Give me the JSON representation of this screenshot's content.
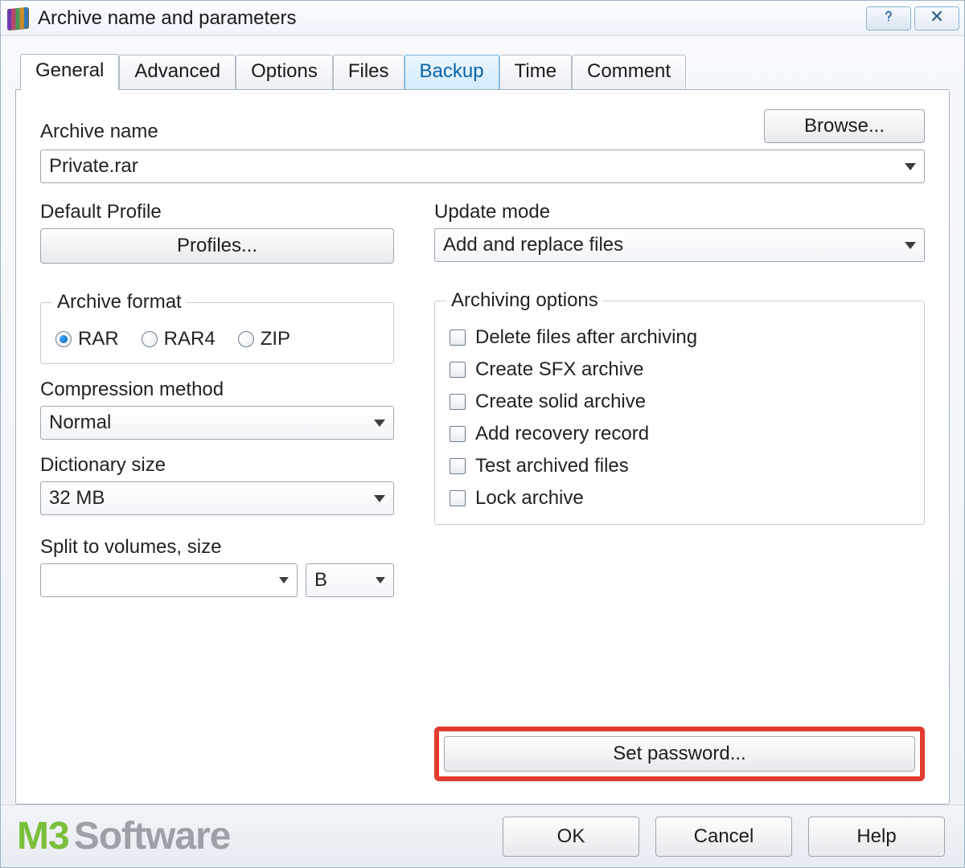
{
  "window": {
    "title": "Archive name and parameters"
  },
  "titlebar_buttons": {
    "help_name": "help-icon",
    "close_name": "close-icon"
  },
  "tabs": [
    {
      "label": "General",
      "active": true
    },
    {
      "label": "Advanced",
      "active": false
    },
    {
      "label": "Options",
      "active": false
    },
    {
      "label": "Files",
      "active": false
    },
    {
      "label": "Backup",
      "active": false,
      "highlight": true
    },
    {
      "label": "Time",
      "active": false
    },
    {
      "label": "Comment",
      "active": false
    }
  ],
  "archive_name": {
    "label": "Archive name",
    "value": "Private.rar",
    "browse_label": "Browse..."
  },
  "default_profile": {
    "label": "Default Profile",
    "button_label": "Profiles..."
  },
  "update_mode": {
    "label": "Update mode",
    "value": "Add and replace files"
  },
  "archive_format": {
    "legend": "Archive format",
    "options": [
      {
        "label": "RAR",
        "checked": true
      },
      {
        "label": "RAR4",
        "checked": false
      },
      {
        "label": "ZIP",
        "checked": false
      }
    ]
  },
  "compression_method": {
    "label": "Compression method",
    "value": "Normal"
  },
  "dictionary_size": {
    "label": "Dictionary size",
    "value": "32 MB"
  },
  "split_volumes": {
    "label": "Split to volumes, size",
    "value": "",
    "unit": "B"
  },
  "archiving_options": {
    "legend": "Archiving options",
    "items": [
      {
        "label": "Delete files after archiving",
        "checked": false
      },
      {
        "label": "Create SFX archive",
        "checked": false
      },
      {
        "label": "Create solid archive",
        "checked": false
      },
      {
        "label": "Add recovery record",
        "checked": false
      },
      {
        "label": "Test archived files",
        "checked": false
      },
      {
        "label": "Lock archive",
        "checked": false
      }
    ]
  },
  "set_password_label": "Set password...",
  "footer": {
    "ok": "OK",
    "cancel": "Cancel",
    "help": "Help"
  },
  "watermark": {
    "brand": "M3",
    "word": "Software"
  }
}
